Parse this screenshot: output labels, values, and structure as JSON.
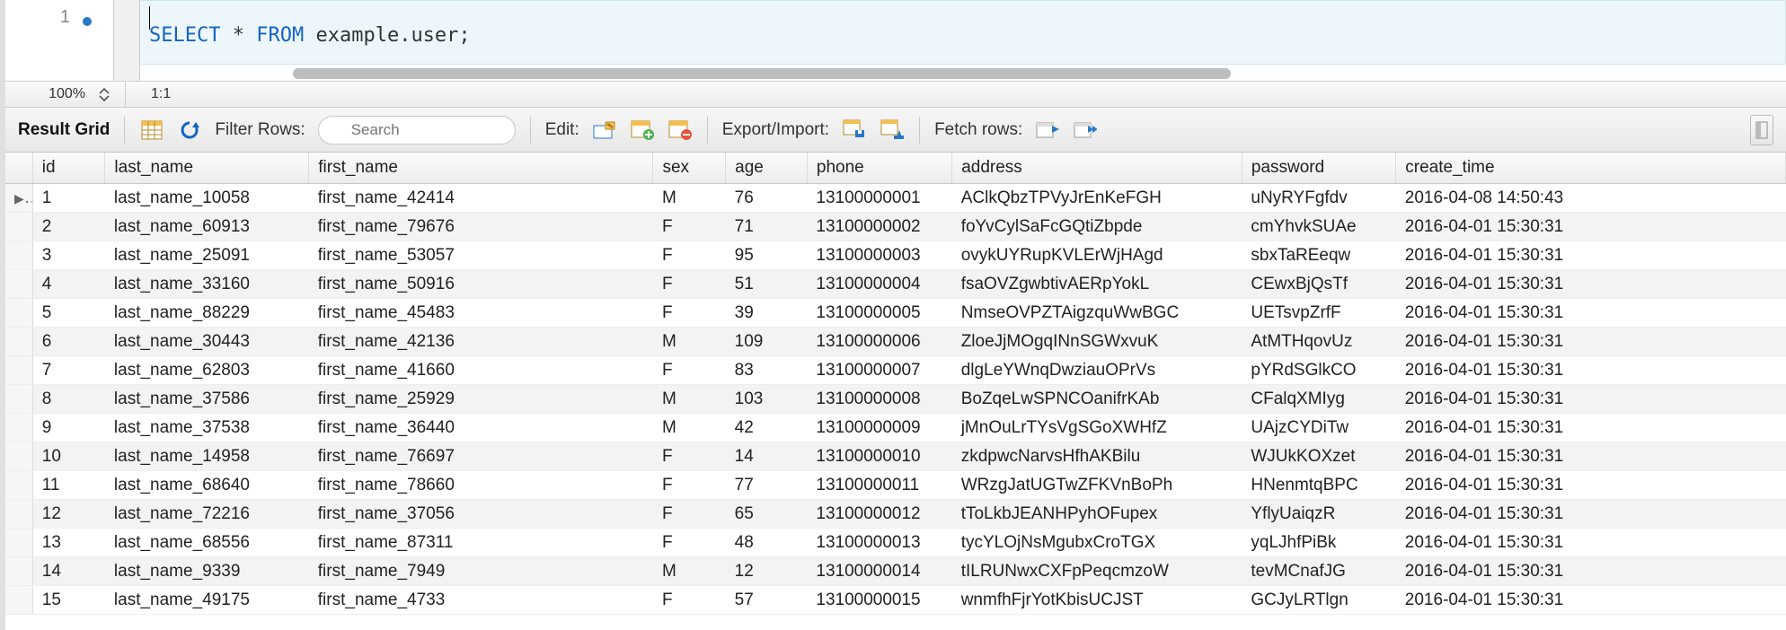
{
  "editor": {
    "line_number": "1",
    "sql_tokens": [
      {
        "t": "SELECT",
        "cls": "kw"
      },
      {
        "t": " ",
        "cls": ""
      },
      {
        "t": "*",
        "cls": "punct"
      },
      {
        "t": " ",
        "cls": ""
      },
      {
        "t": "FROM",
        "cls": "kw"
      },
      {
        "t": " ",
        "cls": ""
      },
      {
        "t": "example",
        "cls": "ident"
      },
      {
        "t": ".",
        "cls": "punct"
      },
      {
        "t": "user",
        "cls": "ident"
      },
      {
        "t": ";",
        "cls": "punct"
      }
    ]
  },
  "statusbar": {
    "zoom": "100%",
    "position": "1:1"
  },
  "toolbar": {
    "result_grid_label": "Result Grid",
    "filter_rows_label": "Filter Rows:",
    "filter_placeholder": "Search",
    "edit_label": "Edit:",
    "export_label": "Export/Import:",
    "fetch_label": "Fetch rows:"
  },
  "grid": {
    "columns": [
      "id",
      "last_name",
      "first_name",
      "sex",
      "age",
      "phone",
      "address",
      "password",
      "create_time"
    ],
    "active_row_index": 0,
    "rows": [
      {
        "id": "1",
        "last_name": "last_name_10058",
        "first_name": "first_name_42414",
        "sex": "M",
        "age": "76",
        "phone": "13100000001",
        "address": "AClkQbzTPVyJrEnKeFGH",
        "password": "uNyRYFgfdv",
        "create_time": "2016-04-08 14:50:43"
      },
      {
        "id": "2",
        "last_name": "last_name_60913",
        "first_name": "first_name_79676",
        "sex": "F",
        "age": "71",
        "phone": "13100000002",
        "address": "foYvCylSaFcGQtiZbpde",
        "password": "cmYhvkSUAe",
        "create_time": "2016-04-01 15:30:31"
      },
      {
        "id": "3",
        "last_name": "last_name_25091",
        "first_name": "first_name_53057",
        "sex": "F",
        "age": "95",
        "phone": "13100000003",
        "address": "ovykUYRupKVLErWjHAgd",
        "password": "sbxTaREeqw",
        "create_time": "2016-04-01 15:30:31"
      },
      {
        "id": "4",
        "last_name": "last_name_33160",
        "first_name": "first_name_50916",
        "sex": "F",
        "age": "51",
        "phone": "13100000004",
        "address": "fsaOVZgwbtivAERpYokL",
        "password": "CEwxBjQsTf",
        "create_time": "2016-04-01 15:30:31"
      },
      {
        "id": "5",
        "last_name": "last_name_88229",
        "first_name": "first_name_45483",
        "sex": "F",
        "age": "39",
        "phone": "13100000005",
        "address": "NmseOVPZTAigzquWwBGC",
        "password": "UETsvpZrfF",
        "create_time": "2016-04-01 15:30:31"
      },
      {
        "id": "6",
        "last_name": "last_name_30443",
        "first_name": "first_name_42136",
        "sex": "M",
        "age": "109",
        "phone": "13100000006",
        "address": "ZloeJjMOgqINnSGWxvuK",
        "password": "AtMTHqovUz",
        "create_time": "2016-04-01 15:30:31"
      },
      {
        "id": "7",
        "last_name": "last_name_62803",
        "first_name": "first_name_41660",
        "sex": "F",
        "age": "83",
        "phone": "13100000007",
        "address": "dlgLeYWnqDwziauOPrVs",
        "password": "pYRdSGlkCO",
        "create_time": "2016-04-01 15:30:31"
      },
      {
        "id": "8",
        "last_name": "last_name_37586",
        "first_name": "first_name_25929",
        "sex": "M",
        "age": "103",
        "phone": "13100000008",
        "address": "BoZqeLwSPNCOanifrKAb",
        "password": "CFalqXMIyg",
        "create_time": "2016-04-01 15:30:31"
      },
      {
        "id": "9",
        "last_name": "last_name_37538",
        "first_name": "first_name_36440",
        "sex": "M",
        "age": "42",
        "phone": "13100000009",
        "address": "jMnOuLrTYsVgSGoXWHfZ",
        "password": "UAjzCYDiTw",
        "create_time": "2016-04-01 15:30:31"
      },
      {
        "id": "10",
        "last_name": "last_name_14958",
        "first_name": "first_name_76697",
        "sex": "F",
        "age": "14",
        "phone": "13100000010",
        "address": "zkdpwcNarvsHfhAKBilu",
        "password": "WJUkKOXzet",
        "create_time": "2016-04-01 15:30:31"
      },
      {
        "id": "11",
        "last_name": "last_name_68640",
        "first_name": "first_name_78660",
        "sex": "F",
        "age": "77",
        "phone": "13100000011",
        "address": "WRzgJatUGTwZFKVnBoPh",
        "password": "HNenmtqBPC",
        "create_time": "2016-04-01 15:30:31"
      },
      {
        "id": "12",
        "last_name": "last_name_72216",
        "first_name": "first_name_37056",
        "sex": "F",
        "age": "65",
        "phone": "13100000012",
        "address": "tToLkbJEANHPyhOFupex",
        "password": "YflyUaiqzR",
        "create_time": "2016-04-01 15:30:31"
      },
      {
        "id": "13",
        "last_name": "last_name_68556",
        "first_name": "first_name_87311",
        "sex": "F",
        "age": "48",
        "phone": "13100000013",
        "address": "tycYLOjNsMgubxCroTGX",
        "password": "yqLJhfPiBk",
        "create_time": "2016-04-01 15:30:31"
      },
      {
        "id": "14",
        "last_name": "last_name_9339",
        "first_name": "first_name_7949",
        "sex": "M",
        "age": "12",
        "phone": "13100000014",
        "address": "tILRUNwxCXFpPeqcmzoW",
        "password": "tevMCnafJG",
        "create_time": "2016-04-01 15:30:31"
      },
      {
        "id": "15",
        "last_name": "last_name_49175",
        "first_name": "first_name_4733",
        "sex": "F",
        "age": "57",
        "phone": "13100000015",
        "address": "wnmfhFjrYotKbisUCJST",
        "password": "GCJyLRTlgn",
        "create_time": "2016-04-01 15:30:31"
      }
    ]
  }
}
